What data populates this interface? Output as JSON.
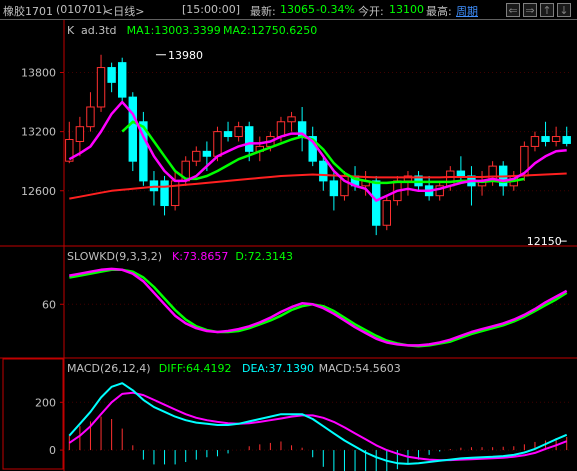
{
  "header": {
    "symbol": "橡胶1701",
    "code": "(010701)",
    "period": "<日线>",
    "time": "[15:00:00]",
    "last_label": "最新:",
    "last_value": "13065",
    "change_pct": "-0.34%",
    "open_label": "今开:",
    "open_value": "13100",
    "high_label": "最高:",
    "cycle_link": "周期",
    "nav_buttons": [
      "⇐",
      "⇒",
      "↑",
      "↓"
    ]
  },
  "colors": {
    "axis": "#c00000",
    "up": "#ff3030",
    "down": "#00ffff",
    "ma1": "#ff00ff",
    "ma2": "#00ff00",
    "ma3": "#ff2020",
    "k": "#ff00ff",
    "d": "#00ff00",
    "diff": "#00ffff",
    "dea": "#ff00ff",
    "macd_up": "#ff3030",
    "macd_down": "#00ffff"
  },
  "chart_data": [
    {
      "type": "candlestick",
      "title_prefix": "K",
      "title": "ad.3td",
      "legend": [
        {
          "label": "MA1:13003.3399",
          "color": "#00ff00"
        },
        {
          "label": "MA2:12750.6250",
          "color": "#00ff00"
        }
      ],
      "y_ticks": [
        13800,
        13200,
        12600
      ],
      "ylim": [
        12080,
        14150
      ],
      "annotations": [
        {
          "text": "13980",
          "x": 8,
          "y": 13980
        },
        {
          "text": "12150",
          "x": 47,
          "y": 12150
        }
      ],
      "ohlc": [
        [
          12900,
          13300,
          12880,
          13120
        ],
        [
          13100,
          13350,
          12950,
          13250
        ],
        [
          13250,
          13600,
          13200,
          13450
        ],
        [
          13450,
          13980,
          13400,
          13850
        ],
        [
          13850,
          13900,
          13600,
          13700
        ],
        [
          13900,
          13950,
          13500,
          13550
        ],
        [
          13550,
          13600,
          12800,
          12900
        ],
        [
          13300,
          13400,
          12650,
          12700
        ],
        [
          12700,
          12800,
          12450,
          12600
        ],
        [
          12700,
          12750,
          12350,
          12450
        ],
        [
          12450,
          12800,
          12400,
          12700
        ],
        [
          12700,
          12950,
          12650,
          12900
        ],
        [
          12900,
          13050,
          12850,
          13000
        ],
        [
          13000,
          13100,
          12800,
          12950
        ],
        [
          12950,
          13250,
          12900,
          13200
        ],
        [
          13200,
          13300,
          13100,
          13150
        ],
        [
          13150,
          13300,
          13100,
          13250
        ],
        [
          13250,
          13300,
          12900,
          13000
        ],
        [
          13000,
          13150,
          12900,
          13050
        ],
        [
          13050,
          13200,
          13000,
          13150
        ],
        [
          13150,
          13350,
          13100,
          13300
        ],
        [
          13300,
          13400,
          13200,
          13350
        ],
        [
          13300,
          13450,
          13000,
          13150
        ],
        [
          13150,
          13250,
          12850,
          12900
        ],
        [
          12900,
          12950,
          12600,
          12700
        ],
        [
          12700,
          12800,
          12400,
          12550
        ],
        [
          12550,
          12800,
          12500,
          12750
        ],
        [
          12750,
          12850,
          12600,
          12650
        ],
        [
          12650,
          12800,
          12550,
          12700
        ],
        [
          12700,
          12750,
          12150,
          12250
        ],
        [
          12250,
          12550,
          12200,
          12500
        ],
        [
          12500,
          12750,
          12450,
          12700
        ],
        [
          12700,
          12800,
          12550,
          12750
        ],
        [
          12750,
          12800,
          12600,
          12650
        ],
        [
          12650,
          12750,
          12500,
          12550
        ],
        [
          12550,
          12700,
          12500,
          12650
        ],
        [
          12650,
          12850,
          12600,
          12800
        ],
        [
          12800,
          12950,
          12700,
          12750
        ],
        [
          12750,
          12850,
          12450,
          12650
        ],
        [
          12650,
          12800,
          12550,
          12700
        ],
        [
          12700,
          12900,
          12650,
          12850
        ],
        [
          12850,
          12900,
          12550,
          12650
        ],
        [
          12650,
          12800,
          12600,
          12750
        ],
        [
          12750,
          13100,
          12700,
          13050
        ],
        [
          13050,
          13200,
          13000,
          13150
        ],
        [
          13150,
          13300,
          13050,
          13100
        ],
        [
          13100,
          13250,
          13050,
          13150
        ],
        [
          13150,
          13250,
          13050,
          13080
        ]
      ],
      "ma1": [
        12920,
        12980,
        13050,
        13200,
        13380,
        13500,
        13380,
        13150,
        12950,
        12800,
        12700,
        12700,
        12750,
        12850,
        12950,
        13000,
        13050,
        13080,
        13080,
        13100,
        13150,
        13180,
        13180,
        13100,
        12950,
        12800,
        12700,
        12650,
        12620,
        12500,
        12550,
        12600,
        12620,
        12600,
        12600,
        12620,
        12650,
        12680,
        12700,
        12700,
        12720,
        12700,
        12720,
        12780,
        12880,
        12950,
        13000,
        13010
      ],
      "ma2": [
        null,
        null,
        null,
        null,
        null,
        13200,
        13300,
        13250,
        13100,
        12950,
        12800,
        12720,
        12720,
        12750,
        12800,
        12860,
        12920,
        12960,
        13000,
        13040,
        13080,
        13120,
        13150,
        13120,
        13020,
        12880,
        12780,
        12720,
        12700,
        12680,
        12680,
        12690,
        12690,
        12690,
        12690,
        12690,
        12690,
        12700,
        12700,
        12690,
        12700,
        12690,
        12700,
        12720,
        null,
        null,
        null,
        null
      ],
      "ma3": [
        12520,
        12540,
        12560,
        12580,
        12600,
        12610,
        12620,
        12630,
        12640,
        12640,
        12650,
        12660,
        12670,
        12680,
        12690,
        12700,
        12710,
        12720,
        12730,
        12740,
        12750,
        12755,
        12760,
        12765,
        12760,
        12755,
        12750,
        12745,
        12740,
        12735,
        12735,
        12735,
        12735,
        12735,
        12735,
        12735,
        12740,
        12740,
        12740,
        12740,
        12745,
        12745,
        12750,
        12755,
        12760,
        12765,
        12770,
        12775
      ]
    },
    {
      "type": "line",
      "title": "SLOWKD(9,3,3,2)",
      "legend": [
        {
          "label": "K:73.8657",
          "color": "#ff00ff"
        },
        {
          "label": "D:72.3143",
          "color": "#00ff00"
        }
      ],
      "y_ticks": [
        60
      ],
      "ylim": [
        8,
        100
      ],
      "k": [
        90,
        92,
        94,
        96,
        97,
        96,
        92,
        84,
        72,
        60,
        48,
        40,
        35,
        32,
        31,
        32,
        34,
        37,
        41,
        46,
        52,
        57,
        61,
        60,
        56,
        50,
        43,
        36,
        30,
        24,
        20,
        18,
        17,
        17,
        18,
        20,
        23,
        27,
        31,
        34,
        37,
        40,
        44,
        49,
        55,
        62,
        68,
        74
      ],
      "d": [
        88,
        90,
        92,
        94,
        96,
        96,
        94,
        88,
        78,
        66,
        54,
        44,
        37,
        33,
        31,
        31,
        32,
        35,
        39,
        43,
        48,
        54,
        58,
        60,
        58,
        53,
        46,
        39,
        33,
        27,
        22,
        19,
        17,
        16,
        17,
        19,
        21,
        25,
        29,
        32,
        35,
        38,
        42,
        47,
        53,
        59,
        65,
        72
      ]
    },
    {
      "type": "line",
      "title": "MACD(26,12,4)",
      "legend": [
        {
          "label": "DIFF:64.4192",
          "color": "#00ff00"
        },
        {
          "label": "DEA:37.1390",
          "color": "#00ffff"
        },
        {
          "label": "MACD:54.5603",
          "color": "#c0c0c0"
        }
      ],
      "y_ticks": [
        200,
        0
      ],
      "ylim": [
        -75,
        310
      ],
      "diff": [
        60,
        110,
        160,
        220,
        265,
        280,
        250,
        210,
        180,
        160,
        140,
        125,
        115,
        110,
        105,
        105,
        110,
        120,
        130,
        140,
        150,
        150,
        150,
        130,
        100,
        70,
        40,
        15,
        -10,
        -30,
        -45,
        -55,
        -58,
        -55,
        -50,
        -45,
        -40,
        -35,
        -32,
        -30,
        -28,
        -25,
        -20,
        -10,
        5,
        25,
        45,
        64
      ],
      "dea": [
        30,
        60,
        100,
        150,
        200,
        235,
        240,
        230,
        210,
        190,
        170,
        150,
        135,
        125,
        118,
        112,
        110,
        112,
        118,
        125,
        132,
        140,
        145,
        145,
        135,
        118,
        95,
        70,
        45,
        20,
        0,
        -15,
        -28,
        -35,
        -40,
        -42,
        -42,
        -40,
        -38,
        -36,
        -34,
        -32,
        -28,
        -22,
        -12,
        5,
        20,
        37
      ],
      "macd": [
        60,
        100,
        120,
        140,
        130,
        90,
        20,
        -40,
        -60,
        -60,
        -60,
        -50,
        -40,
        -30,
        -26,
        -14,
        0,
        16,
        24,
        30,
        36,
        20,
        10,
        -30,
        -70,
        -96,
        -110,
        -110,
        -110,
        -100,
        -90,
        -80,
        -60,
        -40,
        -20,
        -6,
        4,
        10,
        12,
        12,
        12,
        14,
        16,
        24,
        34,
        40,
        50,
        55
      ]
    }
  ]
}
